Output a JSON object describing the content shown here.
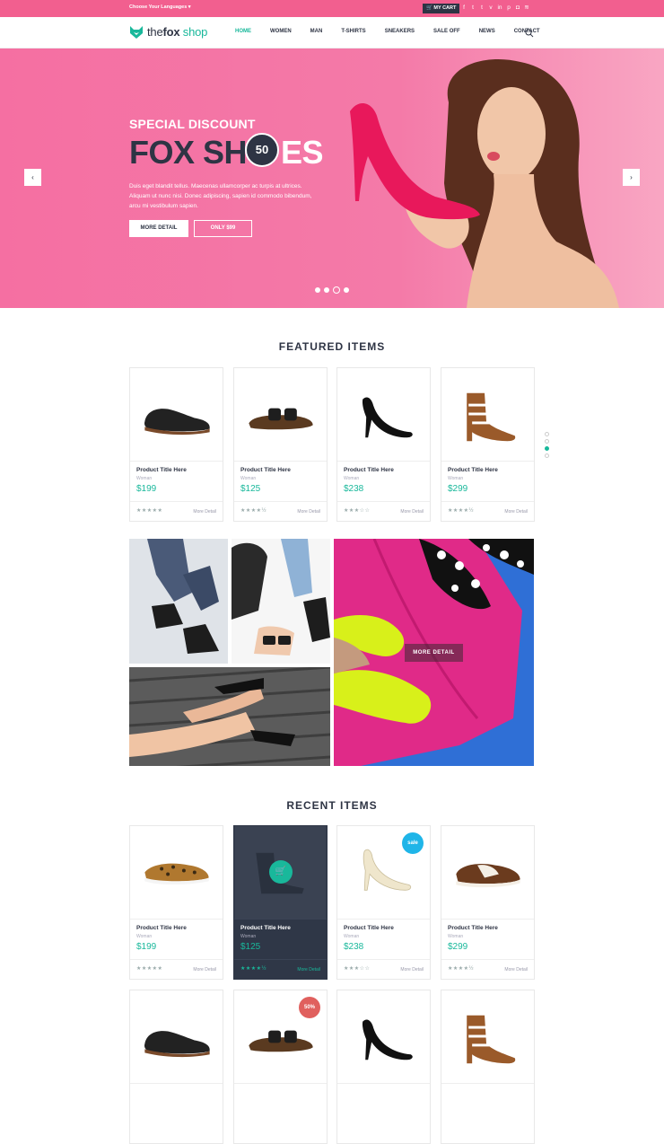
{
  "topbar": {
    "language_label": "Choose Your Languages",
    "cart_label": "MY CART",
    "social_icons": [
      "facebook-icon",
      "twitter-icon",
      "tumblr-icon",
      "vimeo-icon",
      "linkedin-icon",
      "pinterest-icon",
      "instagram-icon",
      "rss-icon"
    ]
  },
  "header": {
    "logo_the": "the",
    "logo_fox": "fox",
    "logo_shop": " shop",
    "nav": [
      "HOME",
      "WOMEN",
      "MAN",
      "T-SHIRTS",
      "SNEAKERS",
      "SALE OFF",
      "NEWS",
      "CONTACT"
    ],
    "active_nav": "HOME"
  },
  "hero": {
    "subtitle": "SPECIAL DISCOUNT",
    "title_a": "FOX SH",
    "title_b": "ES",
    "badge": "50",
    "description": "Duis eget blandit tellus. Maecenas ullamcorper ac turpis at ultrices. Aliquam ut nunc nisi. Donec adipiscing, sapien id commodo bibendum, arcu mi vestibulum sapien.",
    "btn_more": "MORE DETAIL",
    "btn_only": "ONLY $99",
    "slides": 4,
    "active_slide": 3
  },
  "featured": {
    "title": "FEATURED ITEMS",
    "items": [
      {
        "title": "Product Title Here",
        "category": "Woman",
        "price": "$199",
        "rating": 5,
        "more": "More Detail"
      },
      {
        "title": "Product Title Here",
        "category": "Woman",
        "price": "$125",
        "rating": 4.5,
        "more": "More Detail"
      },
      {
        "title": "Product Title Here",
        "category": "Woman",
        "price": "$238",
        "rating": 3,
        "more": "More Detail"
      },
      {
        "title": "Product Title Here",
        "category": "Woman",
        "price": "$299",
        "rating": 4.5,
        "more": "More Detail"
      }
    ]
  },
  "gallery": {
    "overlay_label": "MORE DETAIL"
  },
  "recent": {
    "title": "RECENT ITEMS",
    "items": [
      {
        "title": "Product Title Here",
        "category": "Woman",
        "price": "$199",
        "rating": 5,
        "more": "More Detail"
      },
      {
        "title": "Product Title Here",
        "category": "Woman",
        "price": "$125",
        "rating": 4.5,
        "more": "More Detail"
      },
      {
        "title": "Product Title Here",
        "category": "Woman",
        "price": "$238",
        "rating": 3,
        "more": "More Detail",
        "badge": "sale"
      },
      {
        "title": "Product Title Here",
        "category": "Woman",
        "price": "$299",
        "rating": 4.5,
        "more": "More Detail"
      }
    ],
    "second_row_badge": "50%"
  },
  "colors": {
    "accent": "#19b89b",
    "pink": "#f25f8f",
    "dark": "#2e3444",
    "sale_blue": "#1fb5e8",
    "sale_red": "#e0605e"
  }
}
